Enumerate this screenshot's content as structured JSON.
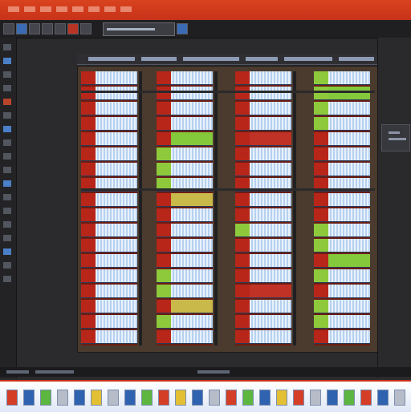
{
  "app": {
    "accent_color": "#c7321a"
  },
  "titlebar": {
    "menu_items": [
      "",
      "",
      "",
      "",
      "",
      "",
      "",
      ""
    ]
  },
  "toolbar": {
    "buttons": [
      "folder-icon",
      "save-icon",
      "undo-icon",
      "redo-icon",
      "open-icon",
      "cut-icon",
      "copy-icon",
      "paste-icon"
    ],
    "file_field": ""
  },
  "left_panel": {
    "tools": [
      "select-icon",
      "move-icon",
      "zoom-icon",
      "pan-icon",
      "cut-icon",
      "paint-icon",
      "text-icon",
      "shape-icon",
      "grid-icon",
      "layer-icon",
      "marker-icon",
      "ruler-icon",
      "eraser-icon",
      "fill-icon",
      "crop-icon",
      "pen-icon",
      "brush-icon",
      "line-icon"
    ]
  },
  "canvas": {
    "columns": 4
  },
  "right_panel": {
    "label": ""
  },
  "status": {
    "text": ""
  },
  "taskbar": {
    "items": [
      "start-icon",
      "browser-icon",
      "folder-icon",
      "media-icon",
      "mail-icon",
      "chat-icon",
      "settings-icon",
      "editor-icon",
      "spreadsheet-icon",
      "image-icon",
      "music-icon",
      "video-icon",
      "terminal-icon",
      "calendar-icon",
      "maps-icon",
      "notes-icon",
      "weather-icon",
      "store-icon",
      "camera-icon",
      "photos-icon",
      "search-icon",
      "clock-icon",
      "network-icon",
      "volume-icon"
    ]
  }
}
